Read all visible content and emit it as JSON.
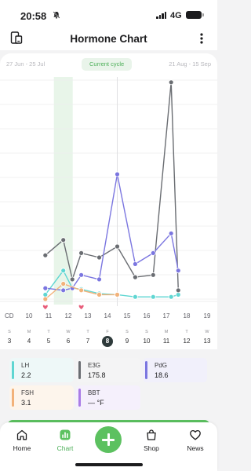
{
  "status_bar": {
    "time": "20:58",
    "network": "4G"
  },
  "header": {
    "title": "Hormone Chart"
  },
  "cycle_nav": {
    "previous": "27 Jun - 25 Jul",
    "current": "Current cycle",
    "next": "21 Aug - 15 Sep"
  },
  "chart_data": {
    "type": "line",
    "x": [
      10,
      11,
      12,
      13,
      14,
      15,
      16,
      17
    ],
    "x_range": [
      8,
      19
    ],
    "xlabel": "CD",
    "highlighted_day": 11,
    "selected_day": 14,
    "heart_days": [
      10,
      12
    ],
    "series": [
      {
        "name": "LH",
        "color": "#5fd6d2",
        "points": [
          [
            10,
            0.02
          ],
          [
            11,
            0.13
          ],
          [
            11.5,
            0.05
          ],
          [
            12,
            0.045
          ],
          [
            13,
            0.025
          ],
          [
            14,
            0.02
          ],
          [
            15,
            0.01
          ],
          [
            16,
            0.01
          ],
          [
            17,
            0.01
          ],
          [
            17.4,
            0.02
          ]
        ]
      },
      {
        "name": "E3G",
        "color": "#6a6d72",
        "points": [
          [
            10,
            0.2
          ],
          [
            11,
            0.27
          ],
          [
            11.5,
            0.09
          ],
          [
            12,
            0.21
          ],
          [
            13,
            0.19
          ],
          [
            14,
            0.24
          ],
          [
            15,
            0.1
          ],
          [
            16,
            0.11
          ],
          [
            17,
            0.99
          ],
          [
            17.4,
            0.04
          ]
        ]
      },
      {
        "name": "PdG",
        "color": "#7b76e0",
        "points": [
          [
            10,
            0.05
          ],
          [
            11,
            0.04
          ],
          [
            11.5,
            0.05
          ],
          [
            12,
            0.11
          ],
          [
            13,
            0.09
          ],
          [
            14,
            0.57
          ],
          [
            15,
            0.16
          ],
          [
            16,
            0.21
          ],
          [
            17,
            0.3
          ],
          [
            17.4,
            0.13
          ]
        ]
      },
      {
        "name": "FSH",
        "color": "#f2b27a",
        "points": [
          [
            10,
            0.0
          ],
          [
            11,
            0.07
          ],
          [
            12,
            0.04
          ],
          [
            13,
            0.02
          ],
          [
            14,
            0.02
          ]
        ]
      }
    ]
  },
  "cd_row": {
    "label": "CD",
    "days": [
      "10",
      "11",
      "12",
      "13",
      "14",
      "15",
      "16",
      "17",
      "18",
      "19"
    ]
  },
  "calendar": [
    {
      "letter": "S",
      "day": "3"
    },
    {
      "letter": "M",
      "day": "4"
    },
    {
      "letter": "T",
      "day": "5"
    },
    {
      "letter": "W",
      "day": "6"
    },
    {
      "letter": "T",
      "day": "7"
    },
    {
      "letter": "F",
      "day": "8"
    },
    {
      "letter": "S",
      "day": "9"
    },
    {
      "letter": "S",
      "day": "10"
    },
    {
      "letter": "M",
      "day": "11"
    },
    {
      "letter": "T",
      "day": "12"
    },
    {
      "letter": "W",
      "day": "13"
    }
  ],
  "calendar_today_index": 5,
  "legend": [
    {
      "name": "LH",
      "value": "2.2",
      "color": "#5fd6d2",
      "bg": "#eef8f8"
    },
    {
      "name": "E3G",
      "value": "175.8",
      "color": "#6a6d72",
      "bg": "#f4f4f5"
    },
    {
      "name": "PdG",
      "value": "18.6",
      "color": "#7b76e0",
      "bg": "#f1f0fb"
    },
    {
      "name": "FSH",
      "value": "3.1",
      "color": "#f2b27a",
      "bg": "#fdf5ec"
    },
    {
      "name": "BBT",
      "value": "— °F",
      "color": "#a97ce6",
      "bg": "#f5f0fc"
    }
  ],
  "bottom_nav": [
    {
      "label": "Home",
      "icon": "home-icon"
    },
    {
      "label": "Chart",
      "icon": "chart-icon",
      "active": true
    },
    {
      "label": "Shop",
      "icon": "shopping-bag-icon"
    },
    {
      "label": "News",
      "icon": "heart-icon"
    }
  ],
  "colors": {
    "accent": "#5cc160",
    "active_tab": "#4caf58"
  }
}
